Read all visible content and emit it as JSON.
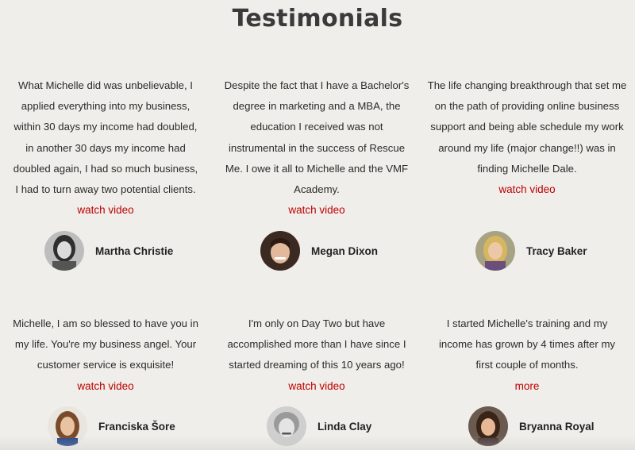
{
  "section": {
    "title": "Testimonials"
  },
  "testimonials": [
    {
      "quote": "What Michelle did was unbelievable, I applied everything into my business, within 30 days my income had doubled, in another 30 days my income had doubled again, I had so much business, I had to turn away two potential clients.",
      "link_label": "watch video",
      "name": "Martha Christie"
    },
    {
      "quote": "Despite the fact that I have a Bachelor's degree in marketing and a MBA, the education I received was not instrumental in the success of Rescue Me. I owe it all to Michelle and the VMF Academy.",
      "link_label": "watch video",
      "name": "Megan Dixon"
    },
    {
      "quote": "The life changing breakthrough that set me on the path of providing online business support and being able schedule my work around my life (major change!!) was in finding Michelle Dale.",
      "link_label": "watch video",
      "name": "Tracy Baker"
    },
    {
      "quote": "Michelle, I am so blessed to have you in my life. You're my business angel. Your customer service is exquisite!",
      "link_label": "watch video",
      "name": "Franciska Šore"
    },
    {
      "quote": "I'm only on Day Two but have accomplished more than I have since I started dreaming of this 10 years ago!",
      "link_label": "watch video",
      "name": "Linda Clay"
    },
    {
      "quote": "I started Michelle's training and my income has grown by 4 times after my first couple of months.",
      "link_label": "more",
      "name": "Bryanna Royal"
    }
  ],
  "colors": {
    "background": "#efeeea",
    "link": "#c00000",
    "title": "#3a3a3a"
  }
}
